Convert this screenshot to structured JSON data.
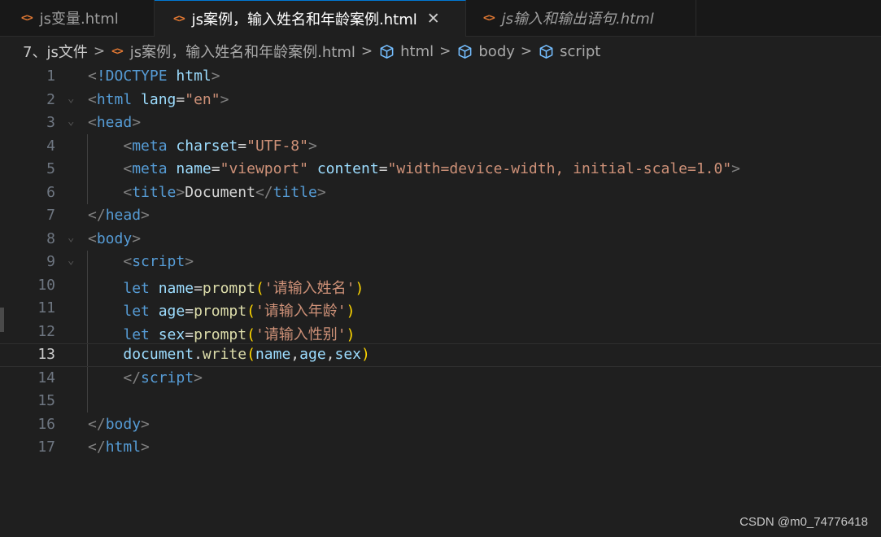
{
  "tabs": [
    {
      "icon": "<>",
      "label": "js变量.html",
      "active": false,
      "italic": false
    },
    {
      "icon": "<>",
      "label": "js案例，输入姓名和年龄案例.html",
      "active": true,
      "italic": false,
      "close": "✕"
    },
    {
      "icon": "<>",
      "label": "js输入和输出语句.html",
      "active": false,
      "italic": true
    }
  ],
  "breadcrumb": [
    "7、js文件",
    "js案例，输入姓名和年龄案例.html",
    "html",
    "body",
    "script"
  ],
  "editor": {
    "current_line": 13,
    "lines": [
      {
        "n": "1"
      },
      {
        "n": "2"
      },
      {
        "n": "3"
      },
      {
        "n": "4"
      },
      {
        "n": "5"
      },
      {
        "n": "6"
      },
      {
        "n": "7"
      },
      {
        "n": "8"
      },
      {
        "n": "9"
      },
      {
        "n": "10"
      },
      {
        "n": "11"
      },
      {
        "n": "12"
      },
      {
        "n": "13"
      },
      {
        "n": "14"
      },
      {
        "n": "15"
      },
      {
        "n": "16"
      },
      {
        "n": "17"
      }
    ],
    "tokens": {
      "doctype_kw": "!DOCTYPE",
      "html": "html",
      "head": "head",
      "meta": "meta",
      "title": "title",
      "body": "body",
      "script": "script",
      "lang_attr": "lang",
      "lang_val": "\"en\"",
      "charset_attr": "charset",
      "charset_val": "\"UTF-8\"",
      "name_attr": "name",
      "name_val": "\"viewport\"",
      "content_attr": "content",
      "content_val": "\"width=device-width, initial-scale=1.0\"",
      "title_text": "Document",
      "let": "let",
      "prompt": "prompt",
      "write": "write",
      "document": "document",
      "var_name": "name",
      "var_age": "age",
      "var_sex": "sex",
      "str_name": "'请输入姓名'",
      "str_age": "'请输入年龄'",
      "str_sex": "'请输入性别'"
    }
  },
  "watermark": "CSDN @m0_74776418"
}
